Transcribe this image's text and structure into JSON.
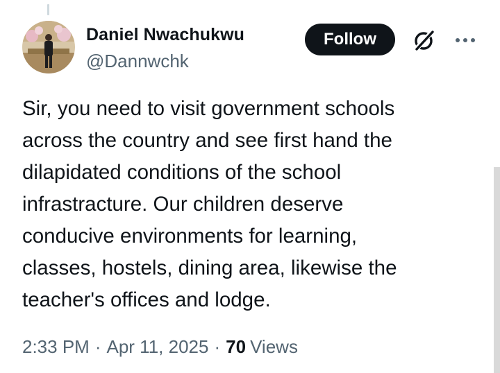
{
  "tweet": {
    "author": {
      "display_name": "Daniel Nwachukwu",
      "handle": "@Dannwchk",
      "avatar_icon": "profile-photo"
    },
    "follow_label": "Follow",
    "grok_icon": "grok-icon",
    "more_icon": "more-icon",
    "text": "Sir, you need to visit government schools\nacross the country and see first hand the\ndilapidated conditions of the school\ninfrastracture. Our children deserve\nconducive environments for learning,\nclasses, hostels, dining area, likewise the\nteacher's offices and lodge.",
    "time": "2:33 PM",
    "separator": "·",
    "date": "Apr 11, 2025",
    "views_count": "70",
    "views_label": "Views"
  },
  "colors": {
    "text_primary": "#0f1419",
    "text_secondary": "#536471",
    "follow_bg": "#0f1419",
    "follow_text": "#ffffff",
    "thread_line": "#cfd9de"
  }
}
